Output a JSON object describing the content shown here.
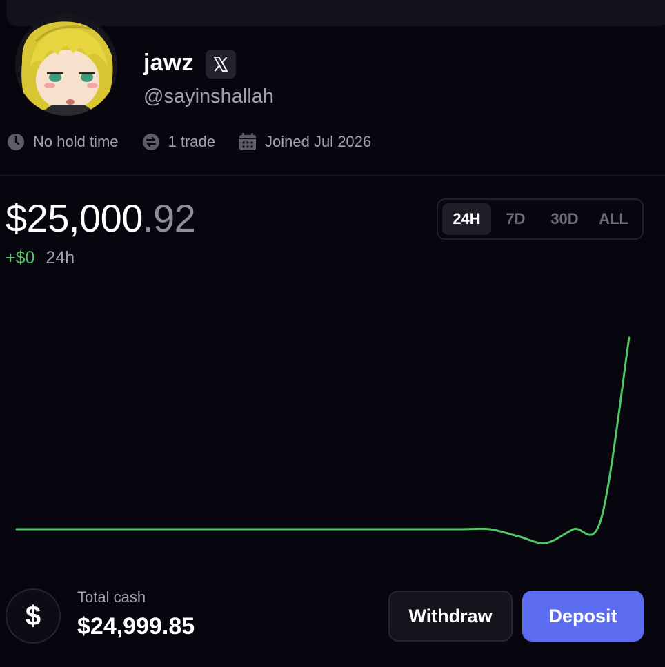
{
  "profile": {
    "username": "jawz",
    "handle": "@sayinshallah",
    "avatar_icon": "anime-avatar",
    "social_icon": "x-logo-icon"
  },
  "stats": {
    "hold_time": "No hold time",
    "trades": "1 trade",
    "joined": "Joined Jul 2026"
  },
  "portfolio": {
    "balance_dollars": "$25,000",
    "balance_cents": ".92",
    "change_amount": "+$0",
    "change_period": "24h"
  },
  "range_tabs": [
    {
      "label": "24H",
      "active": true
    },
    {
      "label": "7D",
      "active": false
    },
    {
      "label": "30D",
      "active": false
    },
    {
      "label": "ALL",
      "active": false
    }
  ],
  "chart_data": {
    "type": "line",
    "color": "#4fc866",
    "title": "",
    "xlabel": "",
    "ylabel": "",
    "series": [
      {
        "values": [
          24999.85,
          24999.85,
          24999.85,
          24999.85,
          24999.85,
          24999.85,
          24999.85,
          24999.85,
          24999.85,
          24999.85,
          24999.85,
          24999.85,
          24999.85,
          24999.85,
          24999.85,
          24999.85,
          24999.85,
          24999.85,
          24999.84,
          24999.83,
          24999.85,
          24999.91,
          25000.92
        ]
      }
    ]
  },
  "cash": {
    "label": "Total cash",
    "value": "$24,999.85",
    "icon": "dollar-icon",
    "symbol": "$"
  },
  "actions": {
    "withdraw_label": "Withdraw",
    "deposit_label": "Deposit"
  },
  "colors": {
    "background": "#07060e",
    "accent": "#5b6cf0",
    "positive": "#4fc866"
  }
}
